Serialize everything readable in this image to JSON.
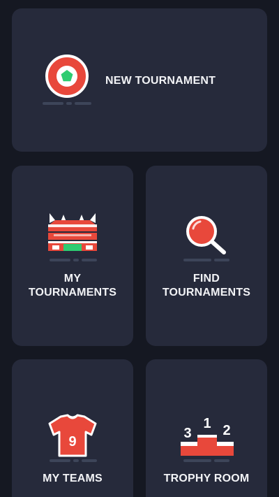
{
  "tiles": {
    "new_tournament": {
      "label": "NEW TOURNAMENT",
      "icon": "pentagon-badge-icon"
    },
    "my_tournaments": {
      "label_line1": "MY",
      "label_line2": "TOURNAMENTS",
      "icon": "stadium-icon"
    },
    "find_tournaments": {
      "label_line1": "FIND",
      "label_line2": "TOURNAMENTS",
      "icon": "magnifier-icon"
    },
    "my_teams": {
      "label": "MY TEAMS",
      "icon": "jersey-icon",
      "jersey_number": "9"
    },
    "trophy_room": {
      "label": "TROPHY ROOM",
      "icon": "podium-icon",
      "podium_numbers": [
        "3",
        "1",
        "2"
      ]
    }
  },
  "colors": {
    "background": "#151822",
    "tile": "#262a3b",
    "accent_red": "#e8483b",
    "accent_green": "#2ecc71",
    "icon_white": "#ffffff",
    "shadow": "#3d4559"
  }
}
